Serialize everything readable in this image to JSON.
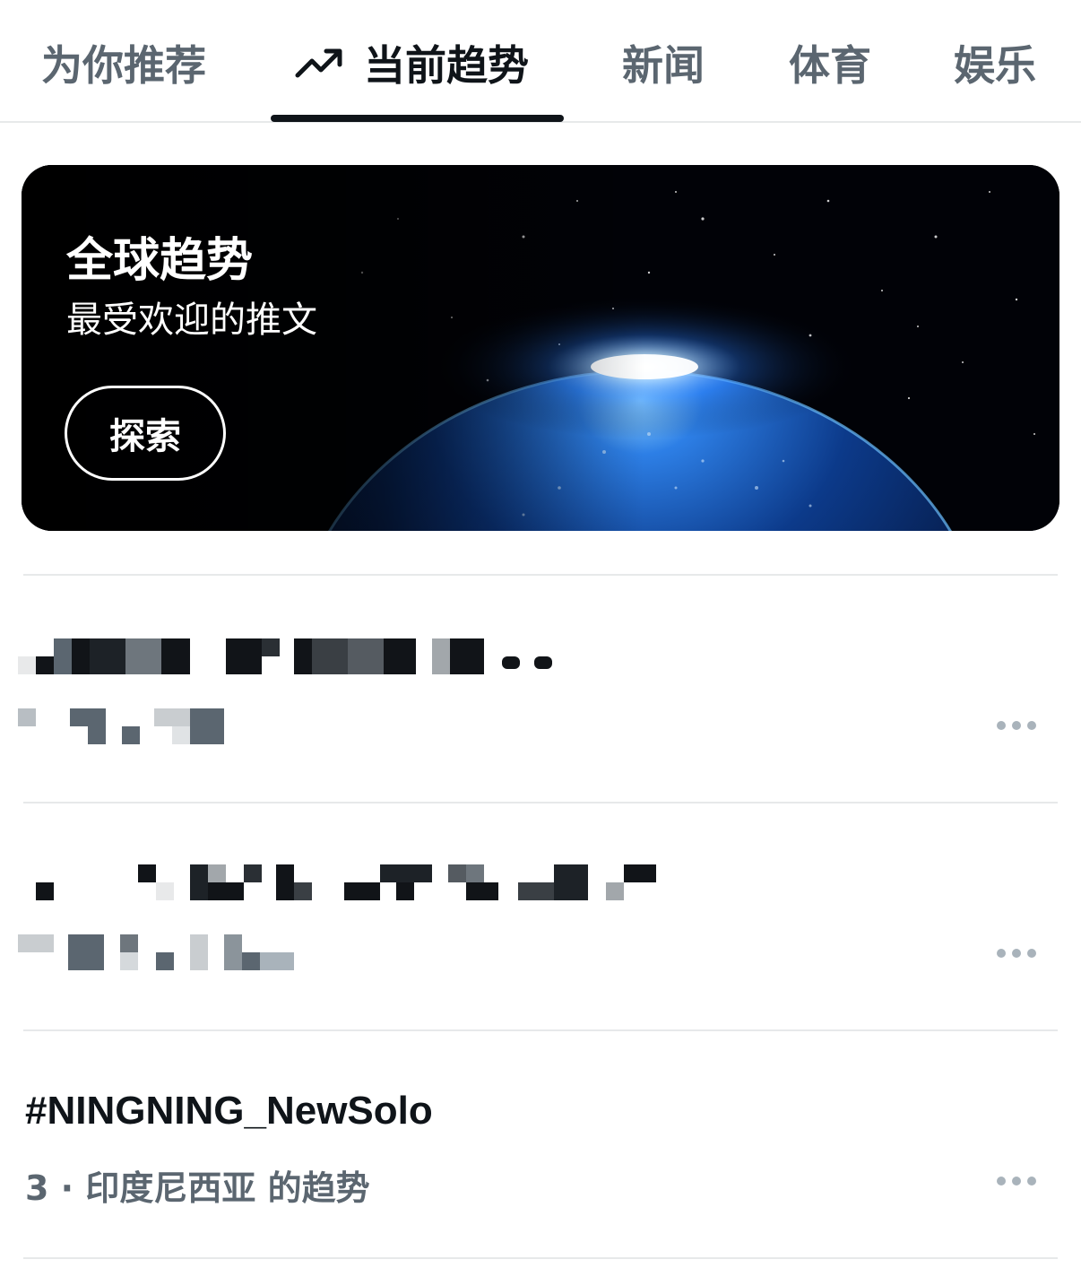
{
  "tabs": [
    {
      "label": "为你推荐",
      "active": false
    },
    {
      "label": "当前趋势",
      "active": true,
      "icon": "trending-icon"
    },
    {
      "label": "新闻",
      "active": false
    },
    {
      "label": "体育",
      "active": false
    },
    {
      "label": "娱乐",
      "active": false
    }
  ],
  "banner": {
    "title": "全球趋势",
    "subtitle": "最受欢迎的推文",
    "button_label": "探索"
  },
  "trends": [
    {
      "name": null,
      "meta": null,
      "redacted": true
    },
    {
      "name": null,
      "meta": null,
      "redacted": true
    },
    {
      "name": "#NINGNING_NewSolo",
      "meta": "3 · 印度尼西亚 的趋势",
      "redacted": false
    }
  ],
  "colors": {
    "text_primary": "#0f1419",
    "text_secondary": "#5b6670",
    "divider": "#e7e9ea",
    "more_dots": "#a9b3bb"
  }
}
